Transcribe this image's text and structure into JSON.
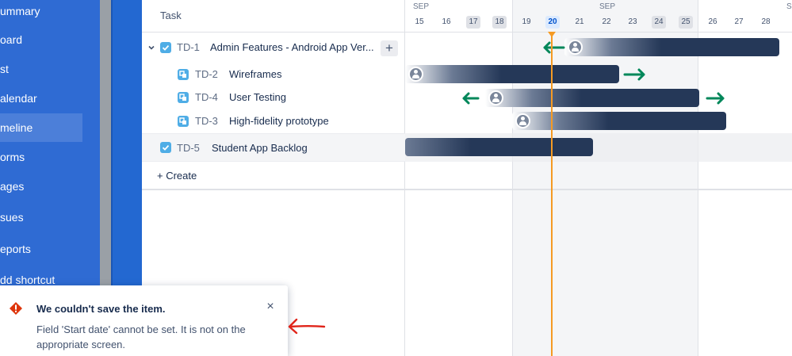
{
  "sidebar": {
    "items": [
      {
        "label": "ummary",
        "active": false
      },
      {
        "label": "oard",
        "active": false
      },
      {
        "label": "st",
        "active": false
      },
      {
        "label": "alendar",
        "active": false
      },
      {
        "label": "meline",
        "active": true
      },
      {
        "label": "orms",
        "active": false
      },
      {
        "label": "ages",
        "active": false
      },
      {
        "label": "sues",
        "active": false
      },
      {
        "label": "eports",
        "active": false
      },
      {
        "label": "dd shortcut",
        "active": false
      }
    ]
  },
  "task_list": {
    "header": "Task",
    "rows": [
      {
        "key": "TD-1",
        "name": "Admin Features - Android App Ver...",
        "type": "task",
        "expanded": true
      },
      {
        "key": "TD-2",
        "name": "Wireframes",
        "type": "subtask"
      },
      {
        "key": "TD-4",
        "name": "User Testing",
        "type": "subtask"
      },
      {
        "key": "TD-3",
        "name": "High-fidelity prototype",
        "type": "subtask"
      },
      {
        "key": "TD-5",
        "name": "Student App Backlog",
        "type": "task"
      }
    ],
    "add_button": "+",
    "create_label": "+ Create"
  },
  "timeline": {
    "months": [
      "SEP",
      "SEP",
      "SE"
    ],
    "days": [
      "15",
      "16",
      "17",
      "18",
      "19",
      "20",
      "21",
      "22",
      "23",
      "24",
      "25",
      "26",
      "27",
      "28"
    ],
    "today": "20",
    "weekend_days": [
      "17",
      "18",
      "24",
      "25"
    ]
  },
  "error_flag": {
    "title": "We couldn't save the item.",
    "body": "Field 'Start date' cannot be set. It is not on the appropriate screen.",
    "close": "×"
  },
  "colors": {
    "sidebar": "#2f6bd3",
    "bar": "#253858",
    "today_line": "#f59a23",
    "arrow_green": "#00875a",
    "annotation_red": "#e0241a",
    "error_icon": "#de350b"
  }
}
